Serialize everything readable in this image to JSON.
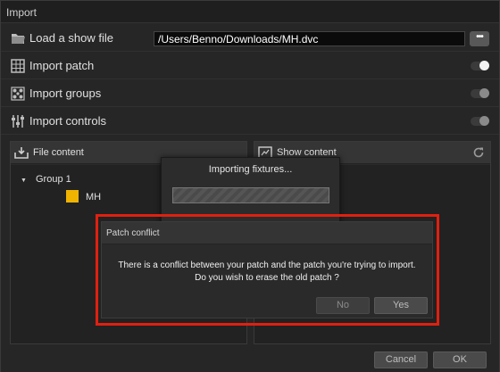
{
  "window": {
    "title": "Import"
  },
  "rows": {
    "load_show": {
      "label": "Load a show file",
      "path": "/Users/Benno/Downloads/MH.dvc",
      "browse_label": "•••"
    },
    "import_patch": {
      "label": "Import patch",
      "enabled": true
    },
    "import_groups": {
      "label": "Import groups",
      "enabled": false
    },
    "import_controls": {
      "label": "Import controls",
      "enabled": false
    }
  },
  "file_content": {
    "title": "File content",
    "tree": [
      {
        "group": "Group 1",
        "items": [
          {
            "name": "MH",
            "color": "#f0b400"
          }
        ]
      }
    ]
  },
  "show_content": {
    "title": "Show content"
  },
  "progress_dialog": {
    "text": "Importing fixtures...",
    "progress": 0.0
  },
  "conflict_dialog": {
    "title": "Patch conflict",
    "message_line1": "There is a conflict between your patch and the patch you're trying to import.",
    "message_line2": "Do you wish to erase the old patch ?",
    "no_label": "No",
    "yes_label": "Yes"
  },
  "footer": {
    "cancel_label": "Cancel",
    "ok_label": "OK"
  },
  "colors": {
    "highlight": "#e02010",
    "background": "#262626",
    "accent": "#f0b400"
  }
}
